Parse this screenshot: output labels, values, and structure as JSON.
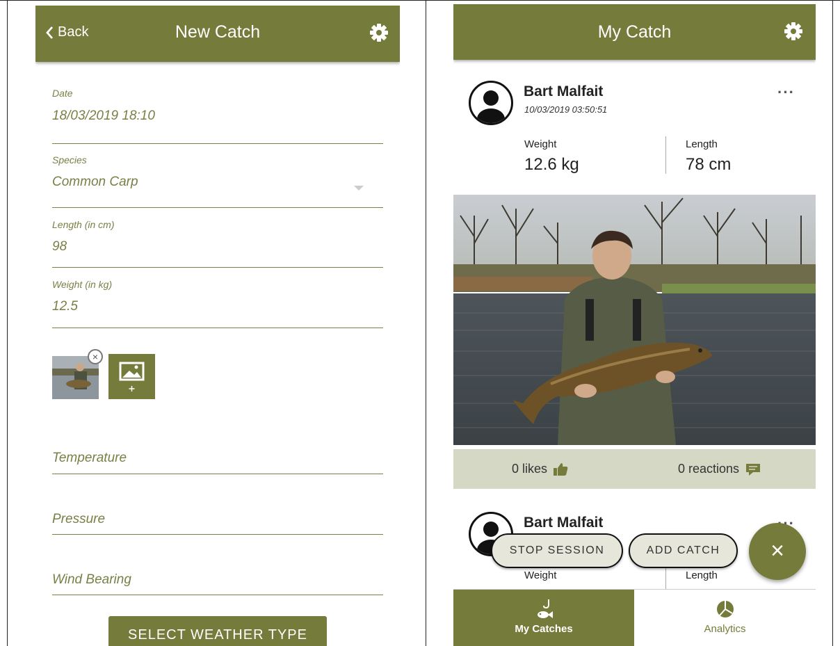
{
  "new_catch": {
    "back_label": "Back",
    "title": "New Catch",
    "date_label": "Date",
    "date_value": "18/03/2019 18:10",
    "species_label": "Species",
    "species_value": "Common Carp",
    "length_label": "Length (in cm)",
    "length_value": "98",
    "weight_label": "Weight (in kg)",
    "weight_value": "12.5",
    "temperature_placeholder": "Temperature",
    "pressure_placeholder": "Pressure",
    "wind_placeholder": "Wind Bearing",
    "weather_button": "SELECT WEATHER TYPE"
  },
  "my_catch": {
    "title": "My Catch",
    "posts": [
      {
        "user": "Bart Malfait",
        "date": "10/03/2019 03:50:51",
        "weight_label": "Weight",
        "weight_value": "12.6 kg",
        "length_label": "Length",
        "length_value": "78 cm",
        "likes": "0 likes",
        "reactions": "0 reactions"
      },
      {
        "user": "Bart Malfait",
        "weight_label": "Weight",
        "length_label": "Length"
      }
    ],
    "stop_session": "STOP SESSION",
    "add_catch": "ADD CATCH",
    "fab_icon": "×",
    "tabs": [
      {
        "label": "My Catches",
        "icon": "fish-hook-icon",
        "active": true
      },
      {
        "label": "Analytics",
        "icon": "pie-chart-icon",
        "active": false
      }
    ]
  },
  "colors": {
    "brand": "#757b3a",
    "reaction_bar": "#d6d8c6",
    "pill_bg": "#e6e6da"
  }
}
